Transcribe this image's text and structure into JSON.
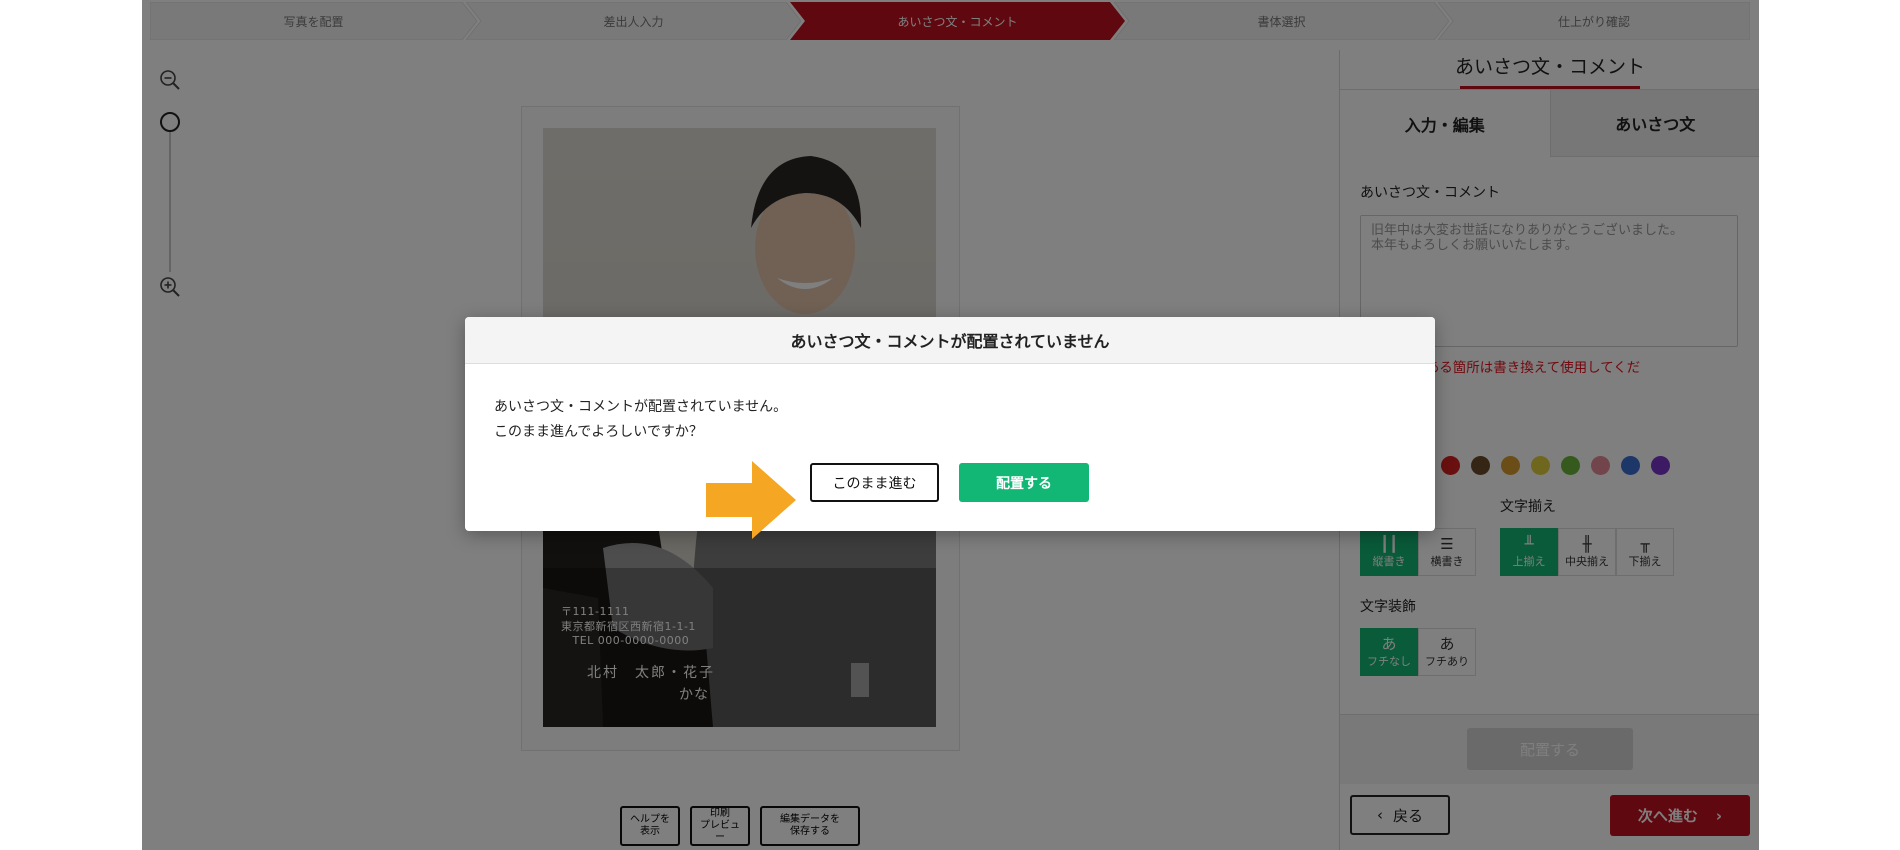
{
  "steps": [
    {
      "label": "写真を配置",
      "active": false
    },
    {
      "label": "差出人入力",
      "active": false
    },
    {
      "label": "あいさつ文・コメント",
      "active": true
    },
    {
      "label": "書体選択",
      "active": false
    },
    {
      "label": "仕上がり確認",
      "active": false
    }
  ],
  "zoom": {
    "out_icon": "zoom-out-icon",
    "in_icon": "zoom-in-icon",
    "level": 0
  },
  "card": {
    "address_lines": [
      "〒111-1111",
      "東京都新宿区西新宿1-1-1",
      "　TEL 000-0000-0000"
    ],
    "names": "北村　太郎・花子",
    "kana": "かな"
  },
  "tools": {
    "help": [
      "ヘルプを",
      "表示"
    ],
    "print": [
      "印刷",
      "プレビュー"
    ],
    "save": [
      "編集データを",
      "保存する"
    ]
  },
  "sidebar": {
    "title": "あいさつ文・コメント",
    "tabs": [
      "入力・編集",
      "あいさつ文"
    ],
    "field_label": "あいさつ文・コメント",
    "comment_placeholder": "旧年中は大変お世話になりありがとうございました。\n本年もよろしくお願いいたします。",
    "warning": "文中に●がある箇所は書き換えて使用してくだ",
    "colors": [
      "#1a1a1a",
      "#d42020",
      "#6b4a2a",
      "#d69a2e",
      "#e1cf3d",
      "#6cb43a",
      "#e58a9a",
      "#3d6fd2",
      "#7a34c8"
    ],
    "align_label": "文字揃え",
    "orientation": [
      "縦書き",
      "横書き"
    ],
    "alignment": [
      "上揃え",
      "中央揃え",
      "下揃え"
    ],
    "decoration_label": "文字装飾",
    "decoration": [
      {
        "glyph": "あ",
        "label": "フチなし"
      },
      {
        "glyph": "あ",
        "label": "フチあり"
      }
    ],
    "place_button": "配置する",
    "back_button": "戻る",
    "next_button": "次へ進む"
  },
  "dialog": {
    "title": "あいさつ文・コメントが配置されていません",
    "message_line1": "あいさつ文・コメントが配置されていません。",
    "message_line2": "このまま進んでよろしいですか？",
    "proceed_button": "このまま進む",
    "place_button": "配置する"
  },
  "colors": {
    "accent_red": "#c0111f",
    "accent_green": "#12b775",
    "arrow_orange": "#f5a623"
  }
}
